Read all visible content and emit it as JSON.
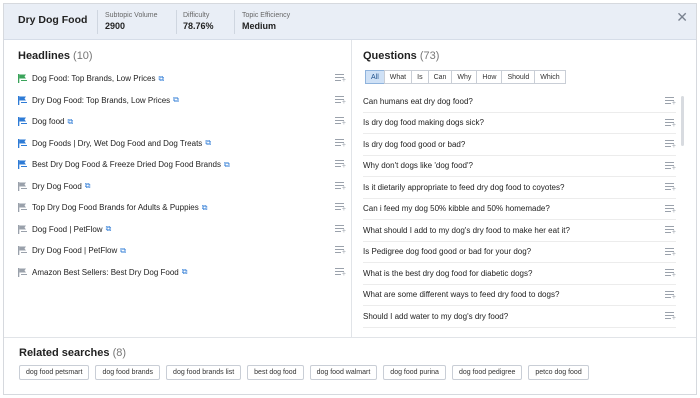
{
  "header": {
    "topic": "Dry Dog Food",
    "metrics": [
      {
        "label": "Subtopic Volume",
        "value": "2900"
      },
      {
        "label": "Difficulty",
        "value": "78.76%"
      },
      {
        "label": "Topic Efficiency",
        "value": "Medium"
      }
    ],
    "close_icon": "close-icon"
  },
  "headlines": {
    "title": "Headlines",
    "count": "(10)",
    "items": [
      {
        "text": "Dog Food: Top Brands, Low Prices",
        "icon": "green-flag"
      },
      {
        "text": "Dry Dog Food: Top Brands, Low Prices",
        "icon": "blue-flag"
      },
      {
        "text": "Dog food",
        "icon": "blue-flag"
      },
      {
        "text": "Dog Foods | Dry, Wet Dog Food and Dog Treats",
        "icon": "blue-flag"
      },
      {
        "text": "Best Dry Dog Food & Freeze Dried Dog Food Brands",
        "icon": "blue-flag"
      },
      {
        "text": "Dry Dog Food",
        "icon": "gray-flag"
      },
      {
        "text": "Top Dry Dog Food Brands for Adults & Puppies",
        "icon": "gray-flag"
      },
      {
        "text": "Dog Food | PetFlow",
        "icon": "gray-flag"
      },
      {
        "text": "Dry Dog Food | PetFlow",
        "icon": "gray-flag"
      },
      {
        "text": "Amazon Best Sellers: Best Dry Dog Food",
        "icon": "gray-flag"
      }
    ]
  },
  "questions": {
    "title": "Questions",
    "count": "(73)",
    "filters": [
      "All",
      "What",
      "Is",
      "Can",
      "Why",
      "How",
      "Should",
      "Which"
    ],
    "active_filter": "All",
    "items": [
      "Can humans eat dry dog food?",
      "Is dry dog food making dogs sick?",
      "Is dry dog food good or bad?",
      "Why don't dogs like 'dog food'?",
      "Is it dietarily appropriate to feed dry dog food to coyotes?",
      "Can i feed my dog 50% kibble and 50% homemade?",
      "What should I add to my dog's dry food to make her eat it?",
      "Is Pedigree dog food good or bad for your dog?",
      "What is the best dry dog food for diabetic dogs?",
      "What are some different ways to feed dry food to dogs?",
      "Should I add water to my dog's dry food?"
    ]
  },
  "related": {
    "title": "Related searches",
    "count": "(8)",
    "tags": [
      "dog food petsmart",
      "dog food brands",
      "dog food brands list",
      "best dog food",
      "dog food walmart",
      "dog food purina",
      "dog food pedigree",
      "petco dog food"
    ]
  },
  "colors": {
    "header_bg": "#e9eef6",
    "link_blue": "#2e7bd6",
    "active_filter_bg": "#cfe1f6",
    "flag_green": "#3aa35a",
    "flag_blue": "#2e7bd6",
    "flag_gray": "#9aa1ab"
  }
}
